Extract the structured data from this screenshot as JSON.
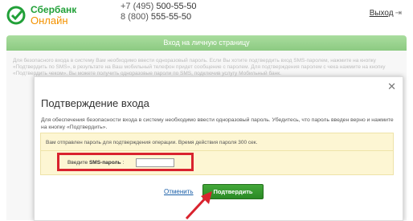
{
  "header": {
    "logo_line1": "Сбербанк",
    "logo_line2": "Онлайн",
    "phone1_prefix": "+7 (495) ",
    "phone1_number": "500-55-50",
    "phone2_prefix": "8 (800) ",
    "phone2_number": "555-55-50",
    "logout_label": "Выход"
  },
  "page": {
    "bar_title": "Вход на личную страницу",
    "bg_text": "Для безопасного входа в систему Вам необходимо ввести одноразовый пароль. Если Вы хотите подтвердить вход SMS-паролем, нажмите на кнопку «Подтвердить по SMS», в результате на Ваш мобильный телефон придет сообщение с паролем. Для подтверждения паролем с чека нажмите на кнопку «Подтвердить чеком». Вы можете получить одноразовые пароли по SMS, подключив услугу Мобильный банк."
  },
  "modal": {
    "title": "Подтверждение входа",
    "description": "Для обеспечения безопасности входа в систему необходимо ввести одноразовый пароль. Убедитесь, что пароль введен верно и нажмите на кнопку «Подтвердить».",
    "info": "Вам отправлен пароль для подтверждения операции. Время действия пароля 300 сек.",
    "sms_label_prefix": "Введите ",
    "sms_label_bold": "SMS-пароль",
    "sms_label_suffix": " :",
    "sms_value": "",
    "cancel_label": "Отменить",
    "confirm_label": "Подтвердить"
  },
  "colors": {
    "brand_green": "#21a038",
    "brand_orange": "#f39200",
    "highlight_red": "#d9232e",
    "button_green": "#2b8a25"
  }
}
